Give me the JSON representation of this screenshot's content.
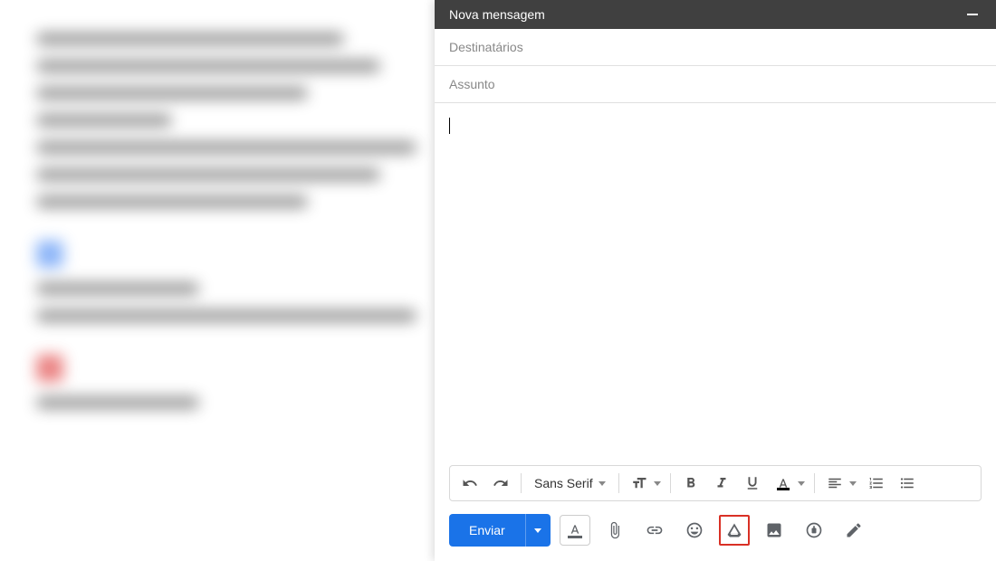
{
  "compose": {
    "title": "Nova mensagem",
    "recipients_placeholder": "Destinatários",
    "subject_placeholder": "Assunto",
    "font_family": "Sans Serif",
    "send_label": "Enviar"
  },
  "icons": {
    "minimize": "minimize",
    "undo": "undo",
    "redo": "redo",
    "font_size": "font-size",
    "bold": "bold",
    "italic": "italic",
    "underline": "underline",
    "text_color": "text-color",
    "align": "align",
    "numbered_list": "numbered-list",
    "bulleted_list": "bulleted-list",
    "formatting_options": "formatting-options",
    "attach": "attach",
    "link": "link",
    "emoji": "emoji",
    "drive": "drive",
    "photo": "photo",
    "confidential": "confidential",
    "pen": "pen"
  }
}
